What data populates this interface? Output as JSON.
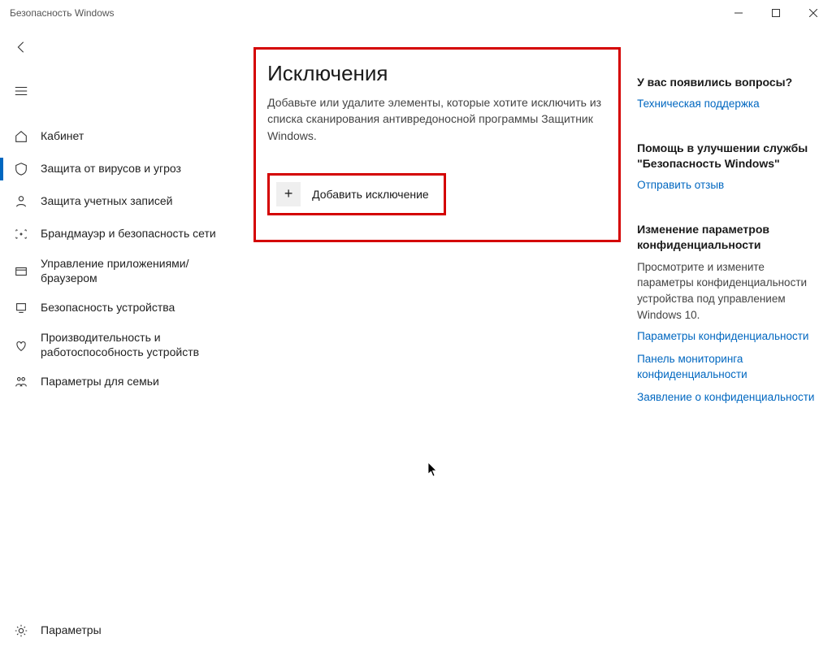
{
  "window": {
    "title": "Безопасность Windows"
  },
  "sidebar": {
    "items": [
      {
        "label": "Кабинет"
      },
      {
        "label": "Защита от вирусов и угроз"
      },
      {
        "label": "Защита учетных записей"
      },
      {
        "label": "Брандмауэр и безопасность сети"
      },
      {
        "label": "Управление приложениями/браузером"
      },
      {
        "label": "Безопасность устройства"
      },
      {
        "label": "Производительность и работоспособность устройств"
      },
      {
        "label": "Параметры для семьи"
      }
    ],
    "bottom": {
      "label": "Параметры"
    }
  },
  "main": {
    "title": "Исключения",
    "description": "Добавьте или удалите элементы, которые хотите исключить из списка сканирования антивредоносной программы Защитник Windows.",
    "add_button": "Добавить исключение"
  },
  "right": {
    "questions": {
      "title": "У вас появились вопросы?",
      "link": "Техническая поддержка"
    },
    "improve": {
      "title": "Помощь в улучшении службы \"Безопасность Windows\"",
      "link": "Отправить отзыв"
    },
    "privacy": {
      "title": "Изменение параметров конфиденциальности",
      "text": "Просмотрите и измените параметры конфиденциальности устройства под управлением Windows 10.",
      "links": [
        "Параметры конфиденциальности",
        "Панель мониторинга конфиденциальности",
        "Заявление о конфиденциальности"
      ]
    }
  }
}
